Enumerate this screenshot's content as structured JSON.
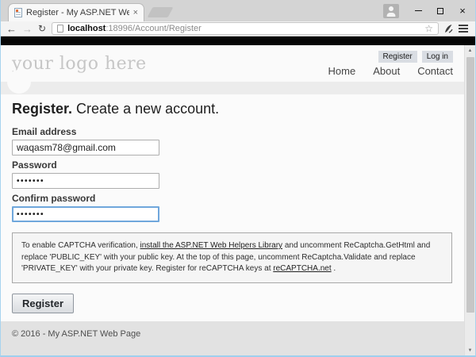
{
  "browser": {
    "tab": {
      "title": "Register - My ASP.NET We",
      "close_icon": "×"
    },
    "controls": {
      "close_icon": "×"
    },
    "toolbar": {
      "back_icon": "←",
      "forward_icon": "→",
      "reload_icon": "↻",
      "star_icon": "☆",
      "url_host": "localhost",
      "url_path": ":18996/Account/Register"
    },
    "scrollbar": {
      "up_icon": "▲",
      "down_icon": "▼"
    }
  },
  "page": {
    "header": {
      "logo_text": "your logo here",
      "register_link": "Register",
      "login_link": "Log in",
      "nav": [
        {
          "label": "Home"
        },
        {
          "label": "About"
        },
        {
          "label": "Contact"
        }
      ]
    },
    "main": {
      "heading_bold": "Register.",
      "heading_rest": " Create a new account.",
      "email_label": "Email address",
      "email_value": "waqasm78@gmail.com",
      "password_label": "Password",
      "password_value": "•••••••",
      "confirm_label": "Confirm password",
      "confirm_value": "•••••••",
      "captcha": {
        "text_1": "To enable CAPTCHA verification, ",
        "link_helpers": "install the ASP.NET Web Helpers Library",
        "text_2": " and uncomment ReCaptcha.GetHtml and replace 'PUBLIC_KEY' with your public key. At the top of this page, uncomment ReCaptcha.Validate and replace 'PRIVATE_KEY' with your private key. Register for reCAPTCHA keys at ",
        "link_recaptcha": "reCAPTCHA.net",
        "text_3": " ."
      },
      "submit_label": "Register"
    },
    "footer": {
      "copyright": "© 2016 - My ASP.NET Web Page"
    }
  },
  "colors": {
    "focus_border": "#6fa7dc",
    "window_border": "#a8d3ee",
    "black_bar": "#060606",
    "header_bg": "#fafafa",
    "footer_bg": "#e2e2e2",
    "auth_button_bg": "#d9dde3"
  }
}
